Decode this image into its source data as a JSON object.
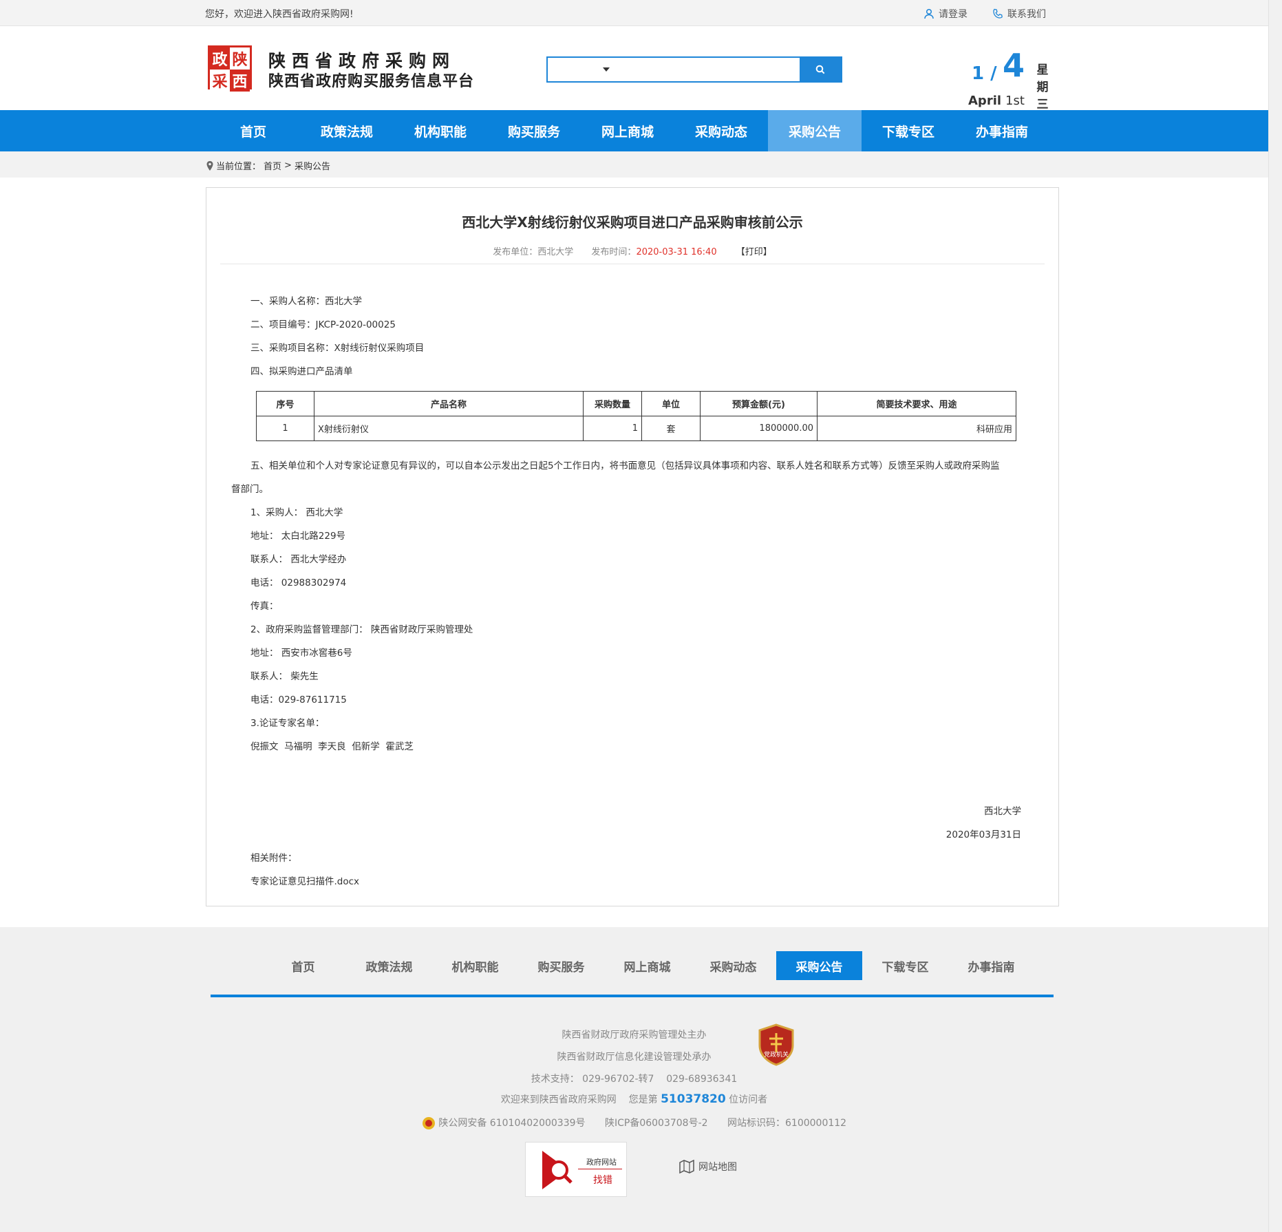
{
  "topbar": {
    "welcome": "您好，欢迎进入陕西省政府采购网!",
    "login": "请登录",
    "contact": "联系我们"
  },
  "header": {
    "logo_chars": [
      "政",
      "陕",
      "采",
      "西"
    ],
    "brand_line1": "陕西省政府采购网",
    "brand_line2": "陕西省政府购买服务信息平台",
    "search_placeholder": "",
    "date": {
      "fraction": "1 /",
      "day_number": "4",
      "month": "April",
      "day": "1st",
      "weekday": [
        "星",
        "期",
        "三"
      ]
    }
  },
  "nav": {
    "items": [
      "首页",
      "政策法规",
      "机构职能",
      "购买服务",
      "网上商城",
      "采购动态",
      "采购公告",
      "下载专区",
      "办事指南"
    ],
    "active_index": 6
  },
  "breadcrumb": {
    "label": "当前位置：",
    "home": "首页",
    "sep": ">",
    "current": "采购公告"
  },
  "article": {
    "title": "西北大学X射线衍射仪采购项目进口产品采购审核前公示",
    "publisher_label": "发布单位：",
    "publisher": "西北大学",
    "time_label": "发布时间：",
    "time": "2020-03-31 16:40",
    "print": "【打印】",
    "lines_top": [
      "一、采购人名称：西北大学",
      "二、项目编号：JKCP-2020-00025",
      "三、采购项目名称：X射线衍射仪采购项目",
      "四、拟采购进口产品清单"
    ],
    "table": {
      "headers": [
        "序号",
        "产品名称",
        "采购数量",
        "单位",
        "预算金额(元)",
        "简要技术要求、用途"
      ],
      "rows": [
        [
          "1",
          "X射线衍射仪",
          "1",
          "套",
          "1800000.00",
          "科研应用"
        ]
      ]
    },
    "para5_line1": "五、相关单位和个人对专家论证意见有异议的，可以自本公示发出之日起5个工作日内，将书面意见（包括异议具体事项和内容、联系人姓名和联系方式等）反馈至采购人或政府采购监",
    "para5_line2": "督部门。",
    "lines_contact": [
      "1、采购人： 西北大学",
      "地址： 太白北路229号",
      "联系人： 西北大学经办",
      "电话： 02988302974",
      "传真：",
      "2、政府采购监督管理部门： 陕西省财政厅采购管理处",
      "地址： 西安市冰窖巷6号",
      "联系人： 柴先生",
      "电话：029-87611715",
      "3.论证专家名单：",
      "倪振文  马福明  李天良  佀新学  霍武芝"
    ],
    "sign_org": "西北大学",
    "sign_date": "2020年03月31日",
    "attach_label": "相关附件：",
    "attach_file": "专家论证意见扫描件.docx"
  },
  "footer": {
    "nav": [
      "首页",
      "政策法规",
      "机构职能",
      "购买服务",
      "网上商城",
      "采购动态",
      "采购公告",
      "下载专区",
      "办事指南"
    ],
    "active_index": 6,
    "host": "陕西省财政厅政府采购管理处主办",
    "organizer": "陕西省财政厅信息化建设管理处承办",
    "support": "技术支持： 029-96702-转7    029-68936341",
    "visit_prefix": "欢迎来到陕西省政府采购网    您是第",
    "visit_count": "51037820",
    "visit_suffix": "位访问者",
    "security": "陕公网安备 61010402000339号",
    "icp": "陕ICP备06003708号-2",
    "site_id": "网站标识码：6100000112",
    "badge_text": "党政机关",
    "errbox_top": "政府网站",
    "errbox_bottom": "找错",
    "sitemap": "网站地图"
  },
  "colors": {
    "brand_blue": "#0a82db",
    "nav_active": "#5aabea",
    "logo_red": "#d42a20",
    "time_red": "#e0322b"
  }
}
